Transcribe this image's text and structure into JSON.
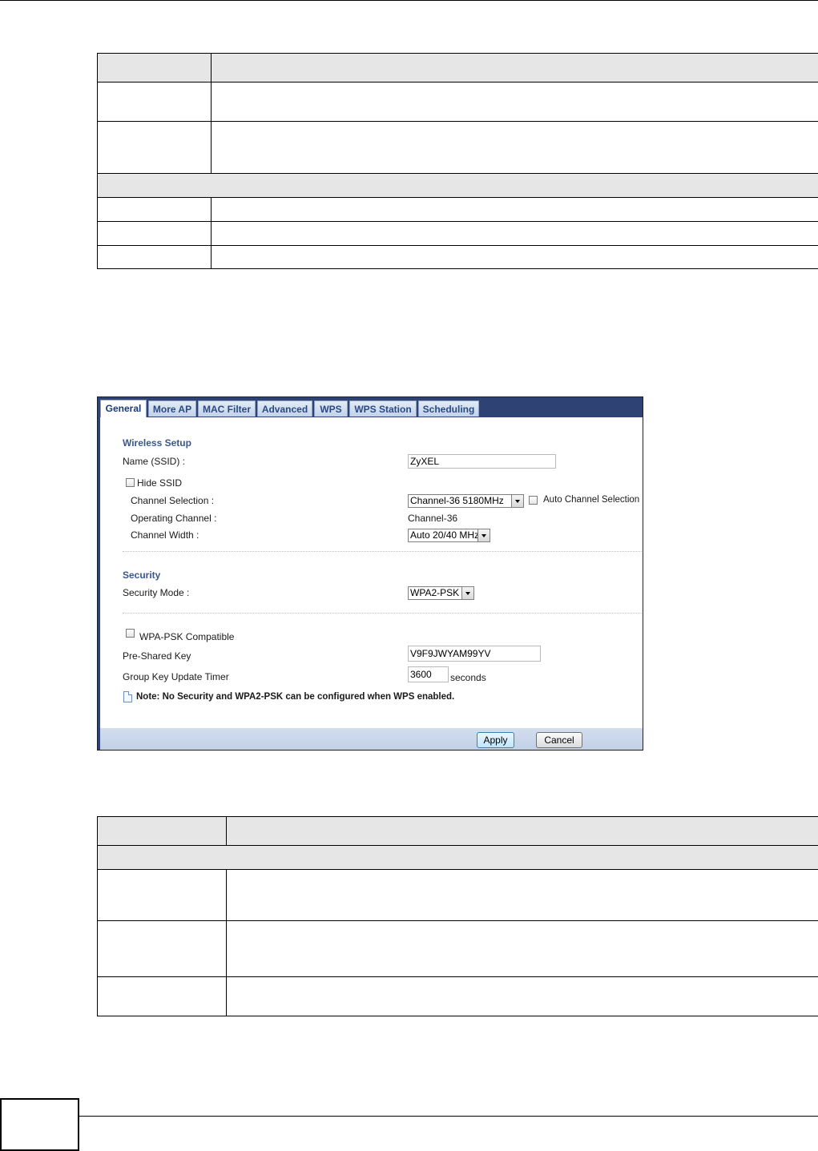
{
  "panel": {
    "tabs": [
      "General",
      "More AP",
      "MAC Filter",
      "Advanced",
      "WPS",
      "WPS Station",
      "Scheduling"
    ],
    "active_tab": "General",
    "wireless_setup": {
      "heading": "Wireless Setup",
      "ssid_label": "Name (SSID) :",
      "ssid_value": "ZyXEL",
      "hide_ssid_label": "Hide SSID",
      "channel_selection_label": "Channel Selection :",
      "channel_selection_value": "Channel-36 5180MHz",
      "auto_channel_label": "Auto Channel Selection",
      "operating_channel_label": "Operating Channel :",
      "operating_channel_value": "Channel-36",
      "channel_width_label": "Channel Width :",
      "channel_width_value": "Auto 20/40 MHz"
    },
    "security": {
      "heading": "Security",
      "mode_label": "Security Mode :",
      "mode_value": "WPA2-PSK",
      "wpa_compat_label": "WPA-PSK Compatible",
      "psk_label": "Pre-Shared Key",
      "psk_value": "V9F9JWYAM99YV",
      "gk_timer_label": "Group Key Update Timer",
      "gk_timer_value": "3600",
      "gk_timer_unit": "seconds"
    },
    "note": "Note: No Security and WPA2-PSK can be configured when WPS enabled.",
    "buttons": {
      "apply": "Apply",
      "cancel": "Cancel"
    }
  }
}
